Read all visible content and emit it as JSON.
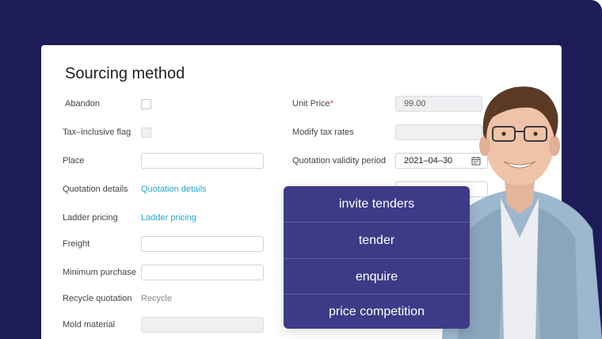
{
  "page_title": "Sourcing method",
  "left_fields": {
    "abandon": "Abandon",
    "tax_flag": "Tax–inclusive flag",
    "place": "Place",
    "quotation_details": "Quotation details",
    "quotation_details_link": "Quotation details",
    "ladder_pricing": "Ladder pricing",
    "ladder_pricing_link": "Ladder pricing",
    "freight": "Freight",
    "minimum_purchase": "Minimum purchase",
    "recycle_quotation": "Recycle quotation",
    "recycle_value": "Recycle",
    "mold_material": "Mold material"
  },
  "right_fields": {
    "unit_price": "Unit Price",
    "unit_price_required": "*",
    "unit_price_value": "99.00",
    "modify_tax_rates": "Modify tax rates",
    "quotation_validity_period": "Quotation validity period",
    "validity_date": "2021–04–30"
  },
  "menu": {
    "items": [
      "invite tenders",
      "tender",
      "enquire",
      "price competition"
    ]
  },
  "colors": {
    "background": "#1d1c58",
    "menu": "#3d3b87",
    "link": "#1fa8cf"
  }
}
